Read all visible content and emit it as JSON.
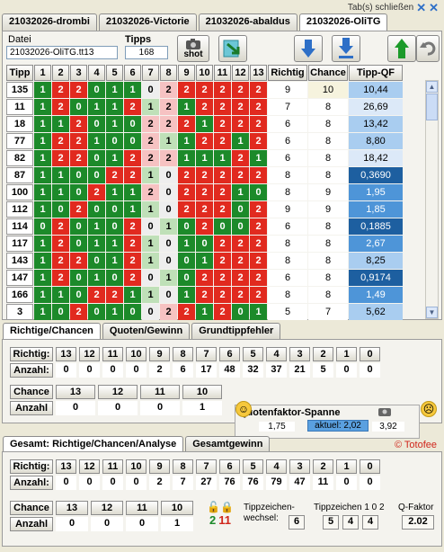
{
  "top": {
    "close_label": "Tab(s) schließen"
  },
  "tabs": [
    "21032026-drombi",
    "21032026-Victorie",
    "21032026-abaldus",
    "21032026-OliTG"
  ],
  "info": {
    "datei_label": "Datei",
    "datei_value": "21032026-OliTG.tt13",
    "tipps_label": "Tipps",
    "tipps_value": "168",
    "shot_label": "shot"
  },
  "grid": {
    "headers": [
      "Tipp",
      "1",
      "2",
      "3",
      "4",
      "5",
      "6",
      "7",
      "8",
      "9",
      "10",
      "11",
      "12",
      "13",
      "Richtig",
      "Chance",
      "Tipp-QF"
    ],
    "rows": [
      {
        "tipp": "135",
        "cells": [
          "1",
          "2",
          "2",
          "0",
          "1",
          "1",
          "0",
          "2",
          "2",
          "2",
          "2",
          "2",
          "2"
        ],
        "richtig": "9",
        "chance": "10",
        "qf": "10,44"
      },
      {
        "tipp": "11",
        "cells": [
          "1",
          "2",
          "0",
          "1",
          "1",
          "2",
          "1",
          "2",
          "1",
          "2",
          "2",
          "2",
          "2"
        ],
        "richtig": "7",
        "chance": "8",
        "qf": "26,69"
      },
      {
        "tipp": "18",
        "cells": [
          "1",
          "1",
          "2",
          "0",
          "1",
          "0",
          "2",
          "2",
          "2",
          "1",
          "2",
          "2",
          "2"
        ],
        "richtig": "6",
        "chance": "8",
        "qf": "13,42"
      },
      {
        "tipp": "77",
        "cells": [
          "1",
          "2",
          "2",
          "1",
          "0",
          "0",
          "2",
          "1",
          "1",
          "2",
          "2",
          "1",
          "2"
        ],
        "richtig": "6",
        "chance": "8",
        "qf": "8,80"
      },
      {
        "tipp": "82",
        "cells": [
          "1",
          "2",
          "2",
          "0",
          "1",
          "2",
          "2",
          "2",
          "1",
          "1",
          "1",
          "2",
          "1"
        ],
        "richtig": "6",
        "chance": "8",
        "qf": "18,42"
      },
      {
        "tipp": "87",
        "cells": [
          "1",
          "1",
          "0",
          "0",
          "2",
          "2",
          "1",
          "0",
          "2",
          "2",
          "2",
          "2",
          "2"
        ],
        "richtig": "8",
        "chance": "8",
        "qf": "0,3690"
      },
      {
        "tipp": "100",
        "cells": [
          "1",
          "1",
          "0",
          "2",
          "1",
          "1",
          "2",
          "0",
          "2",
          "2",
          "2",
          "1",
          "0"
        ],
        "richtig": "8",
        "chance": "9",
        "qf": "1,95"
      },
      {
        "tipp": "112",
        "cells": [
          "1",
          "0",
          "2",
          "0",
          "0",
          "1",
          "1",
          "0",
          "2",
          "2",
          "2",
          "0",
          "2"
        ],
        "richtig": "9",
        "chance": "9",
        "qf": "1,85"
      },
      {
        "tipp": "114",
        "cells": [
          "0",
          "2",
          "0",
          "1",
          "0",
          "2",
          "0",
          "1",
          "0",
          "2",
          "0",
          "0",
          "2"
        ],
        "richtig": "6",
        "chance": "8",
        "qf": "0,1885"
      },
      {
        "tipp": "117",
        "cells": [
          "1",
          "2",
          "0",
          "1",
          "1",
          "2",
          "1",
          "0",
          "1",
          "0",
          "2",
          "2",
          "2"
        ],
        "richtig": "8",
        "chance": "8",
        "qf": "2,67"
      },
      {
        "tipp": "143",
        "cells": [
          "1",
          "2",
          "2",
          "0",
          "1",
          "2",
          "1",
          "0",
          "0",
          "1",
          "2",
          "2",
          "2"
        ],
        "richtig": "8",
        "chance": "8",
        "qf": "8,25"
      },
      {
        "tipp": "147",
        "cells": [
          "1",
          "2",
          "0",
          "1",
          "0",
          "2",
          "0",
          "1",
          "0",
          "2",
          "2",
          "2",
          "2"
        ],
        "richtig": "6",
        "chance": "8",
        "qf": "0,9174"
      },
      {
        "tipp": "166",
        "cells": [
          "1",
          "1",
          "0",
          "2",
          "2",
          "1",
          "1",
          "0",
          "1",
          "2",
          "2",
          "2",
          "2"
        ],
        "richtig": "8",
        "chance": "8",
        "qf": "1,49"
      },
      {
        "tipp": "3",
        "cells": [
          "1",
          "0",
          "2",
          "0",
          "1",
          "0",
          "0",
          "2",
          "2",
          "1",
          "2",
          "0",
          "1"
        ],
        "richtig": "5",
        "chance": "7",
        "qf": "5,62"
      }
    ],
    "hit_pattern": [
      [
        "1",
        "1",
        "0",
        "0",
        "1",
        "1",
        "0",
        "0",
        "1",
        "1",
        "1",
        "1",
        "1"
      ],
      [
        "1",
        "1",
        "0",
        "1",
        "1",
        "1",
        "1",
        "0",
        "1",
        "1",
        "1",
        "1",
        "1"
      ],
      [
        "1",
        "1",
        "1",
        "0",
        "1",
        "0",
        "0",
        "0",
        "1",
        "0",
        "1",
        "1",
        "1"
      ],
      [
        "1",
        "1",
        "1",
        "1",
        "0",
        "0",
        "0",
        "0",
        "0",
        "1",
        "1",
        "0",
        "1"
      ],
      [
        "1",
        "1",
        "1",
        "0",
        "1",
        "1",
        "0",
        "0",
        "0",
        "0",
        "0",
        "1",
        "0"
      ],
      [
        "1",
        "1",
        "1",
        "0",
        "1",
        "1",
        "1",
        "0",
        "1",
        "1",
        "1",
        "1",
        "1"
      ],
      [
        "1",
        "1",
        "1",
        "1",
        "1",
        "1",
        "1",
        "0",
        "1",
        "1",
        "1",
        "1",
        "1"
      ],
      [
        "1",
        "1",
        "1",
        "0",
        "1",
        "1",
        "1",
        "0",
        "1",
        "1",
        "1",
        "1",
        "1"
      ],
      [
        "1",
        "1",
        "1",
        "1",
        "1",
        "1",
        "0",
        "0",
        "1",
        "1",
        "1",
        "1",
        "1"
      ],
      [
        "1",
        "1",
        "1",
        "1",
        "1",
        "1",
        "1",
        "0",
        "1",
        "1",
        "1",
        "1",
        "1"
      ],
      [
        "1",
        "1",
        "1",
        "0",
        "1",
        "1",
        "1",
        "0",
        "1",
        "1",
        "1",
        "1",
        "1"
      ],
      [
        "1",
        "1",
        "1",
        "1",
        "1",
        "1",
        "0",
        "0",
        "1",
        "1",
        "1",
        "1",
        "1"
      ],
      [
        "1",
        "1",
        "1",
        "1",
        "1",
        "1",
        "1",
        "0",
        "1",
        "1",
        "1",
        "1",
        "1"
      ],
      [
        "1",
        "1",
        "1",
        "0",
        "1",
        "1",
        "0",
        "0",
        "1",
        "1",
        "1",
        "1",
        "1"
      ]
    ]
  },
  "sub1": {
    "tabs": [
      "Richtige/Chancen",
      "Quoten/Gewinn",
      "Grundtippfehler"
    ],
    "richtig_label": "Richtig:",
    "anzahl_label": "Anzahl:",
    "richtig": [
      "13",
      "12",
      "11",
      "10",
      "9",
      "8",
      "7",
      "6",
      "5",
      "4",
      "3",
      "2",
      "1",
      "0"
    ],
    "anzahl": [
      "0",
      "0",
      "0",
      "0",
      "2",
      "6",
      "17",
      "48",
      "32",
      "37",
      "21",
      "5",
      "0",
      "0"
    ],
    "chance_label": "Chance",
    "anzahl2_label": "Anzahl",
    "chance": [
      "13",
      "12",
      "11",
      "10"
    ],
    "chance_anzahl": [
      "0",
      "0",
      "0",
      "1"
    ],
    "qf_title": "Quotenfaktor-Spanne",
    "qf_min": "1,75",
    "qf_current": "aktuel: 2,02",
    "qf_max": "3,92"
  },
  "sub2": {
    "tabs": [
      "Gesamt: Richtige/Chancen/Analyse",
      "Gesamtgewinn"
    ],
    "totofee": "© Totofee",
    "richtig_label": "Richtig:",
    "anzahl_label": "Anzahl:",
    "richtig": [
      "13",
      "12",
      "11",
      "10",
      "9",
      "8",
      "7",
      "6",
      "5",
      "4",
      "3",
      "2",
      "1",
      "0"
    ],
    "anzahl": [
      "0",
      "0",
      "0",
      "0",
      "2",
      "7",
      "27",
      "76",
      "76",
      "79",
      "47",
      "11",
      "0",
      "0"
    ],
    "chance_label": "Chance",
    "anzahl2_label": "Anzahl",
    "chance": [
      "13",
      "12",
      "11",
      "10"
    ],
    "chance_anzahl": [
      "0",
      "0",
      "0",
      "1"
    ],
    "lock_open": "2",
    "lock_closed": "11",
    "tippzeichen_label": "Tippzeichen-\nwechsel:",
    "tippzeichen_value": "6",
    "tz102_label": "Tippzeichen 1 0 2",
    "tz102_values": [
      "5",
      "4",
      "4"
    ],
    "qfaktor_label": "Q-Faktor",
    "qfaktor_value": "2.02"
  },
  "colors": {
    "red": "#e12a1f",
    "green": "#1c8a2a",
    "light_green": "#bfe0b8",
    "light_red": "#f6c2c2"
  }
}
